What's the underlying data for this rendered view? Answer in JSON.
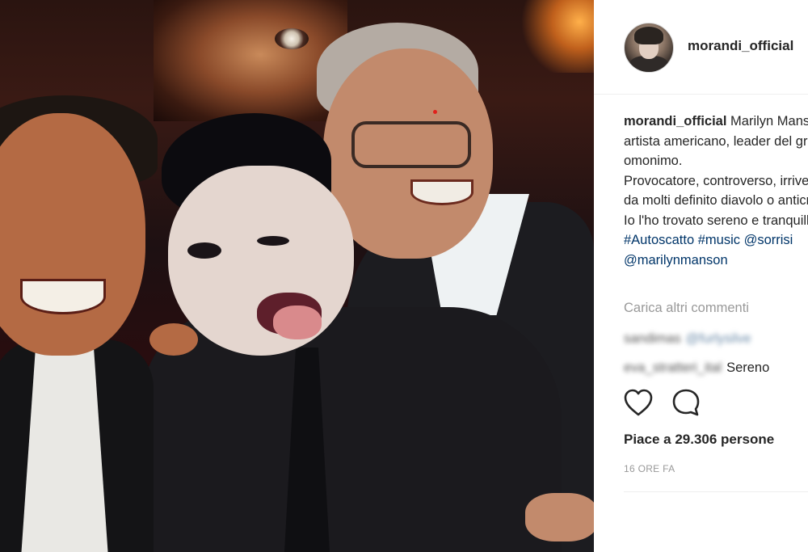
{
  "post": {
    "username": "morandi_official",
    "caption_lines": [
      "Marilyn Manson,",
      "artista americano, leader del gruppo",
      "omonimo.",
      "Provocatore, controverso, irriverente,",
      "da molti definito diavolo o anticristo.",
      "Io l'ho trovato sereno e tranquillo.",
      "#Autoscatto #music @sorrisi",
      "@marilynmanson"
    ],
    "caption_user": "morandi_official",
    "load_more": "Carica altri commenti",
    "comments": [
      {
        "user": "sandimas",
        "text": "@furlysilve"
      },
      {
        "user": "eva_stratteri_ital",
        "text": "Sereno"
      }
    ],
    "likes": "Piace a 29.306 persone",
    "time": "16 ORE FA"
  },
  "icons": {
    "like": "heart-outline-icon",
    "comment": "speech-bubble-icon",
    "avatar": "profile-photo"
  },
  "colors": {
    "text": "#262626",
    "muted": "#999999",
    "hashtag": "#003569"
  }
}
